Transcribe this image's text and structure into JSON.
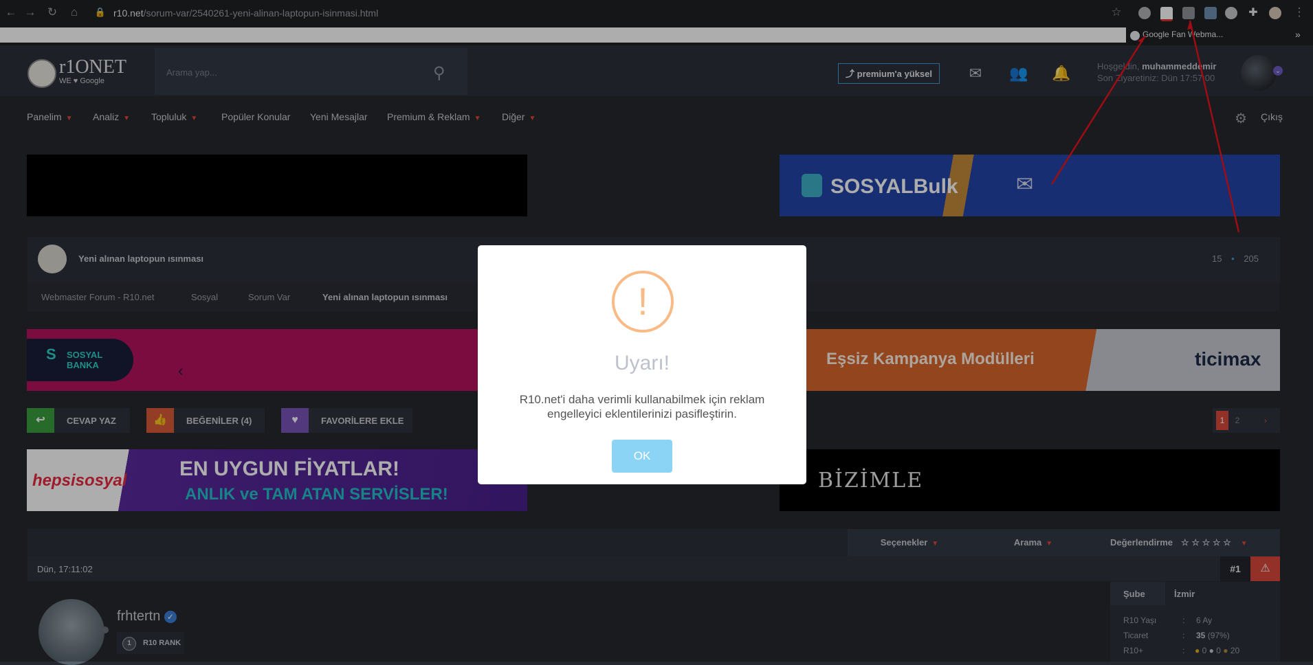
{
  "browser": {
    "url_domain": "r10.net",
    "url_path": "/sorum-var/2540261-yeni-alinan-laptopun-isinmasi.html",
    "bookmark": "Google Fan Webma...",
    "more": "»"
  },
  "header": {
    "logo_text": "r1ONET",
    "logo_sub": "WE ♥ Google",
    "search_placeholder": "Arama yap...",
    "premium_label": "⤴ premium'a yüksel",
    "welcome_prefix": "Hoşgeldin,",
    "username": "muhammeddemir",
    "last_visit": "Son Ziyaretiniz: Dün 17:57:00"
  },
  "nav": {
    "items": [
      "Panelim",
      "Analiz",
      "Topluluk",
      "Popüler Konular",
      "Yeni Mesajlar",
      "Premium & Reklam",
      "Diğer"
    ],
    "logout": "Çıkış"
  },
  "ads": {
    "sosyalbulk": "SOSYALBulk",
    "sosyalbanka": "SOSYAL BANKA",
    "ticimax_text": "Eşsiz Kampanya Modülleri",
    "ticimax_logo": "ticimax",
    "hepsi_logo": "hepsisosyal",
    "hepsi_line1": "EN UYGUN FİYATLAR!",
    "hepsi_line2": "ANLIK ve TAM ATAN SERVİSLER!",
    "bizimle": "BİZİMLE"
  },
  "thread": {
    "title": "Yeni alınan laptopun ısınması",
    "replies": "15",
    "views": "205",
    "breadcrumb": [
      "Webmaster Forum - R10.net",
      "Sosyal",
      "Sorum Var",
      "Yeni alınan laptopun ısınması"
    ]
  },
  "actions": {
    "reply": "CEVAP YAZ",
    "likes": "BEĞENİLER (4)",
    "favorite": "FAVORİLERE EKLE",
    "pages": [
      "1",
      "2"
    ]
  },
  "toolbar": {
    "options": "Seçenekler",
    "search": "Arama",
    "rating": "Değerlendirme",
    "stars": "☆ ☆ ☆ ☆ ☆"
  },
  "post": {
    "date": "Dün, 17:11:02",
    "number": "#1",
    "username": "frhtertn",
    "rank": "R10 RANK",
    "rank_num": "1",
    "sube_label": "Şube",
    "sube_value": "İzmir",
    "r10_yas_label": "R10 Yaşı",
    "r10_yas_value": "6 Ay",
    "ticaret_label": "Ticaret",
    "ticaret_value": "35",
    "ticaret_pct": "(97%)",
    "r10plus_label": "R10+",
    "r10plus_values": [
      "0",
      "0",
      "20"
    ]
  },
  "modal": {
    "icon": "!",
    "title": "Uyarı!",
    "text": "R10.net'i daha verimli kullanabilmek için reklam engelleyici eklentilerinizi pasifleştirin.",
    "ok": "OK"
  },
  "colors": {
    "accent_red": "#e4463b",
    "warning_orange": "#f8bb86",
    "ok_blue": "#8cd4f5",
    "annotation_red": "#e8141c"
  }
}
